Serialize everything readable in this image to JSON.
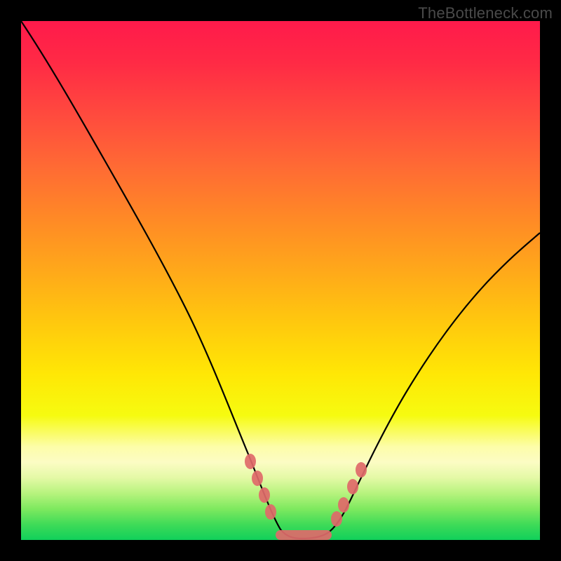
{
  "watermark": {
    "text": "TheBottleneck.com"
  },
  "chart_data": {
    "type": "line",
    "title": "",
    "xlabel": "",
    "ylabel": "",
    "xlim": [
      0,
      100
    ],
    "ylim": [
      0,
      100
    ],
    "series": [
      {
        "name": "curve",
        "color": "#000000",
        "x": [
          0,
          5,
          10,
          15,
          20,
          25,
          30,
          35,
          40,
          45,
          48,
          50,
          52,
          55,
          58,
          60,
          63,
          66,
          70,
          75,
          80,
          85,
          90,
          95,
          100
        ],
        "y": [
          100,
          92,
          84,
          76,
          67,
          58,
          49,
          40,
          30,
          18,
          10,
          4,
          1,
          0,
          0,
          1,
          3,
          7,
          13,
          22,
          31,
          39,
          46,
          52,
          57
        ]
      },
      {
        "name": "markers",
        "color": "#e57373",
        "type": "scatter",
        "x": [
          42,
          44,
          46,
          49,
          52,
          55,
          58,
          60,
          62,
          64
        ],
        "y": [
          13,
          9,
          5,
          2,
          1,
          1,
          2,
          4,
          7,
          11
        ]
      }
    ],
    "annotations": []
  }
}
